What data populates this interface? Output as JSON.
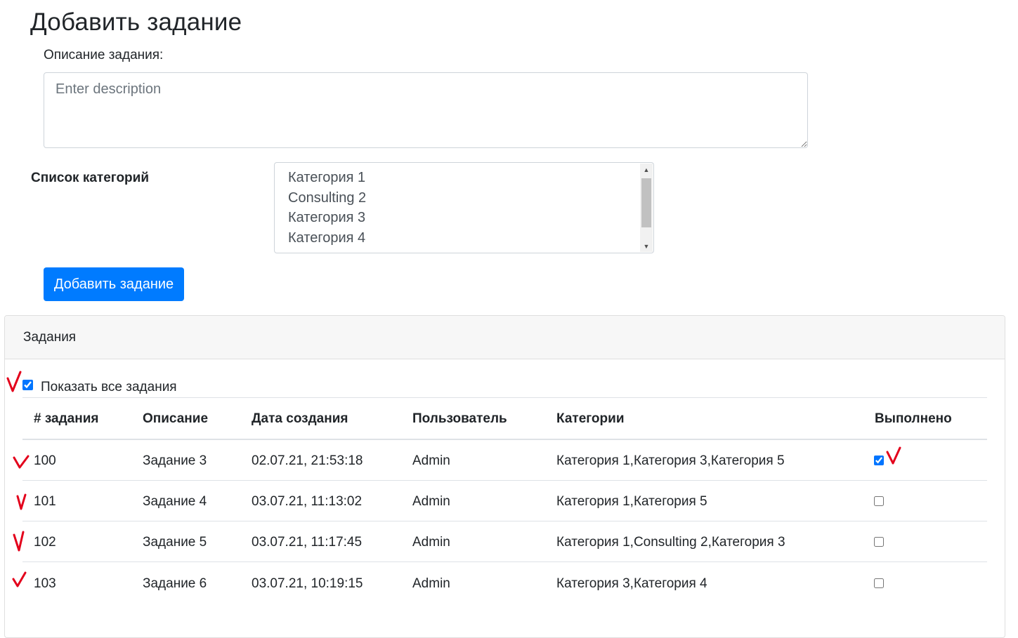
{
  "page": {
    "title": "Добавить задание"
  },
  "form": {
    "description_label": "Описание задания:",
    "description_value": "",
    "description_placeholder": "Enter description",
    "categories_label": "Список категорий",
    "categories": [
      "Категория 1",
      "Consulting 2",
      "Категория 3",
      "Категория 4"
    ],
    "submit_label": "Добавить задание"
  },
  "tasks_card": {
    "title": "Задания",
    "show_all_label": "Показать все задания",
    "show_all_checked": true,
    "columns": [
      "# задания",
      "Описание",
      "Дата создания",
      "Пользователь",
      "Категории",
      "Выполнено"
    ],
    "rows": [
      {
        "id": "100",
        "description": "Задание 3",
        "created": "02.07.21, 21:53:18",
        "user": "Admin",
        "categories": "Категория 1,Категория 3,Категория 5",
        "done": true
      },
      {
        "id": "101",
        "description": "Задание 4",
        "created": "03.07.21, 11:13:02",
        "user": "Admin",
        "categories": "Категория 1,Категория 5",
        "done": false
      },
      {
        "id": "102",
        "description": "Задание 5",
        "created": "03.07.21, 11:17:45",
        "user": "Admin",
        "categories": "Категория 1,Consulting 2,Категория 3",
        "done": false
      },
      {
        "id": "103",
        "description": "Задание 6",
        "created": "03.07.21, 10:19:15",
        "user": "Admin",
        "categories": "Категория 3,Категория 4",
        "done": false
      }
    ]
  },
  "colors": {
    "primary": "#007bff",
    "annotation_mark": "#e3001b",
    "card_header_bg": "#f7f7f7"
  },
  "icons": {
    "annotation": "red-checkmark-icon",
    "scroll_up": "scroll-up-arrow-icon",
    "scroll_down": "scroll-down-arrow-icon"
  }
}
